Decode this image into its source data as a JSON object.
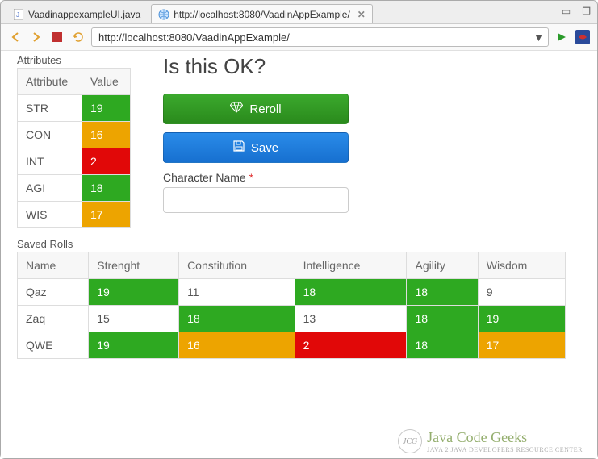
{
  "tabs": {
    "editor": {
      "label": "VaadinappexampleUI.java"
    },
    "browser": {
      "label": "http://localhost:8080/VaadinAppExample/"
    }
  },
  "toolbar": {
    "url": "http://localhost:8080/VaadinAppExample/"
  },
  "attributes": {
    "title": "Attributes",
    "headers": {
      "col1": "Attribute",
      "col2": "Value"
    },
    "rows": [
      {
        "name": "STR",
        "value": "19",
        "class": "green"
      },
      {
        "name": "CON",
        "value": "16",
        "class": "orange"
      },
      {
        "name": "INT",
        "value": "2",
        "class": "red"
      },
      {
        "name": "AGI",
        "value": "18",
        "class": "green"
      },
      {
        "name": "WIS",
        "value": "17",
        "class": "orange"
      }
    ]
  },
  "right": {
    "heading": "Is this OK?",
    "reroll": "Reroll",
    "save": "Save",
    "charname_label": "Character Name",
    "charname_value": ""
  },
  "saved": {
    "title": "Saved Rolls",
    "headers": {
      "name": "Name",
      "str": "Strenght",
      "con": "Constitution",
      "int": "Intelligence",
      "agi": "Agility",
      "wis": "Wisdom"
    },
    "rows": [
      {
        "name": "Qaz",
        "str": {
          "v": "19",
          "c": "green"
        },
        "con": {
          "v": "11",
          "c": "none"
        },
        "int": {
          "v": "18",
          "c": "green"
        },
        "agi": {
          "v": "18",
          "c": "green"
        },
        "wis": {
          "v": "9",
          "c": "none"
        }
      },
      {
        "name": "Zaq",
        "str": {
          "v": "15",
          "c": "none"
        },
        "con": {
          "v": "18",
          "c": "green"
        },
        "int": {
          "v": "13",
          "c": "none"
        },
        "agi": {
          "v": "18",
          "c": "green"
        },
        "wis": {
          "v": "19",
          "c": "green"
        }
      },
      {
        "name": "QWE",
        "str": {
          "v": "19",
          "c": "green"
        },
        "con": {
          "v": "16",
          "c": "orange"
        },
        "int": {
          "v": "2",
          "c": "red"
        },
        "agi": {
          "v": "18",
          "c": "green"
        },
        "wis": {
          "v": "17",
          "c": "orange"
        }
      }
    ]
  },
  "watermark": {
    "main": "Java Code Geeks",
    "sub": "JAVA 2 JAVA DEVELOPERS RESOURCE CENTER"
  }
}
